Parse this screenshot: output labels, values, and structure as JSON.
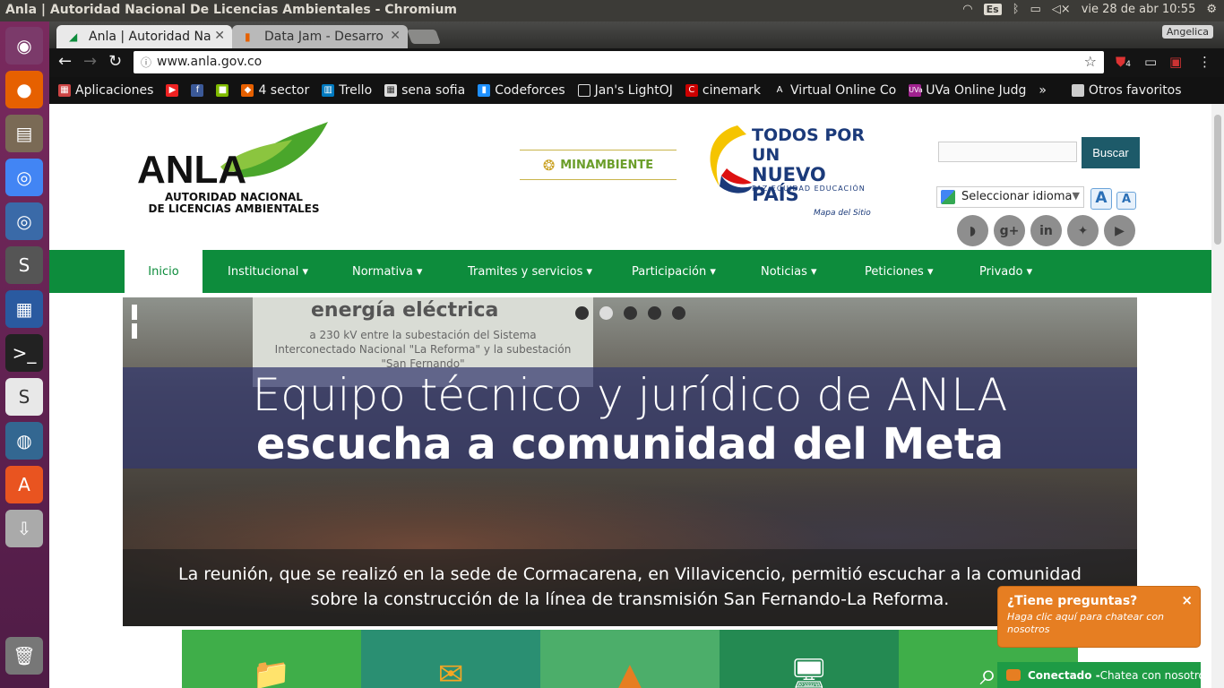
{
  "os": {
    "window_title": "Anla | Autoridad Nacional De Licencias Ambientales - Chromium",
    "keyboard_layout": "Es",
    "clock": "vie 28 de abr 10:55"
  },
  "browser": {
    "tabs": [
      {
        "label": "Anla | Autoridad Na"
      },
      {
        "label": "Data Jam - Desarro"
      }
    ],
    "profile": "Angelica",
    "url": "www.anla.gov.co",
    "bookmarks": [
      "Aplicaciones",
      "4 sector",
      "Trello",
      "sena sofia",
      "Codeforces",
      "Jan's LightOJ",
      "cinemark",
      "Virtual Online Co",
      "UVa Online Judg"
    ],
    "other_bookmarks": "Otros favoritos",
    "more": "»",
    "ext_badge": "4"
  },
  "site": {
    "logo_text": "ANLA",
    "logo_sub_line1": "AUTORIDAD NACIONAL",
    "logo_sub_line2": "DE LICENCIAS  AMBIENTALES",
    "minambiente": "MINAMBIENTE",
    "todos_line1": "TODOS POR UN",
    "todos_line2": "NUEVO PAÍS",
    "todos_tag": "PAZ  EQUIDAD  EDUCACIÓN",
    "mapa": "Mapa del Sitio",
    "search_button": "Buscar",
    "language": "Seleccionar idioma",
    "font_large": "A",
    "font_small": "A",
    "social": [
      "rss",
      "g+",
      "in",
      "twitter",
      "youtube"
    ],
    "menu": [
      "Inicio",
      "Institucional",
      "Normativa",
      "Tramites y servicios",
      "Participación",
      "Noticias",
      "Peticiones",
      "Privado"
    ],
    "slide": {
      "sign_title": "energía eléctrica",
      "sign_text": "a 230 kV entre la subestación del Sistema Interconectado Nacional \"La Reforma\" y la subestación \"San Fernando\"",
      "headline_line1": "Equipo técnico y jurídico de ANLA",
      "headline_line2": "escucha a comunidad del Meta",
      "caption_line1": "La reunión, que se realizó en la sede de Cormacarena, en Villavicencio, permitió escuchar a la comunidad",
      "caption_line2": "sobre la construcción de la línea de transmisión San Fernando-La Reforma."
    },
    "chat": {
      "question": "¿Tiene preguntas?",
      "sub": "Haga clic aquí para chatear con nosotros",
      "close": "×",
      "status_bold": "Conectado -",
      "status_rest": " Chatea con nosotros"
    },
    "colors": {
      "green": "#0d8c3c",
      "buscar": "#1d5a69",
      "chat": "#e67e22"
    }
  }
}
